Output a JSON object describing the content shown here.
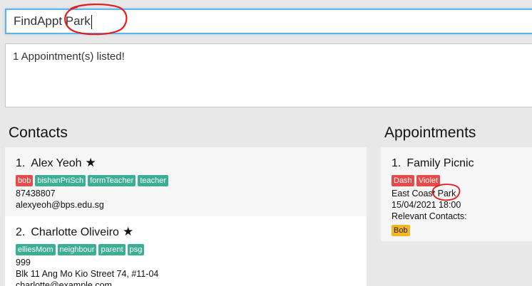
{
  "command": {
    "value": "FindAppt Park"
  },
  "result": {
    "text": "1 Appointment(s) listed!"
  },
  "contacts": {
    "heading": "Contacts",
    "items": [
      {
        "index": "1.",
        "name": "Alex Yeoh",
        "favourite": "★",
        "tags": [
          "bob",
          "bishanPriSch",
          "formTeacher",
          "teacher"
        ],
        "phone": "87438807",
        "email": "alexyeoh@bps.edu.sg"
      },
      {
        "index": "2.",
        "name": "Charlotte Oliveiro",
        "favourite": "★",
        "tags": [
          "elliesMom",
          "neighbour",
          "parent",
          "psg"
        ],
        "phone": "999",
        "address": "Blk 11 Ang Mo Kio Street 74, #11-04",
        "email": "charlotte@example.com"
      }
    ]
  },
  "appointments": {
    "heading": "Appointments",
    "items": [
      {
        "index": "1.",
        "title": "Family Picnic",
        "tags": [
          "Dash",
          "Violet"
        ],
        "location_prefix": "East Coast",
        "location_match": "Park",
        "datetime": "15/04/2021 18:00",
        "relevant_label": "Relevant Contacts:",
        "contacts": [
          "Bob"
        ]
      }
    ]
  },
  "colors": {
    "accent_border": "#5fb3ea",
    "annotation": "#e21b1b",
    "tag_red": "#e84a4a",
    "tag_green": "#3aaf93",
    "tag_yellow": "#f2b81e"
  }
}
